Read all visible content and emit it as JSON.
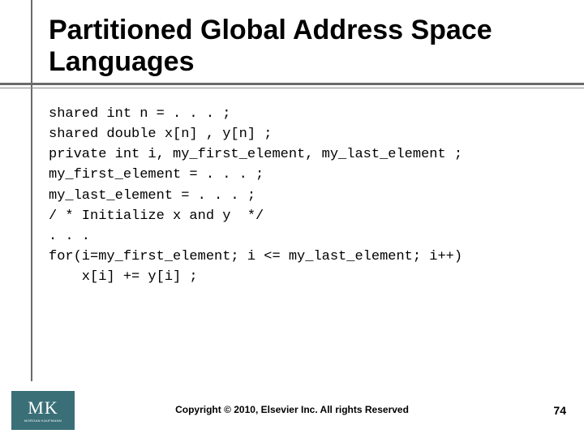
{
  "title": "Partitioned Global Address Space Languages",
  "code_lines": [
    "shared int n = . . . ;",
    "shared double x[n] , y[n] ;",
    "private int i, my_first_element, my_last_element ;",
    "my_first_element = . . . ;",
    "my_last_element = . . . ;",
    "/ * Initialize x and y  */",
    ". . .",
    "for(i=my_first_element; i <= my_last_element; i++)",
    "    x[i] += y[i] ;"
  ],
  "copyright": "Copyright © 2010, Elsevier Inc. All rights Reserved",
  "page_number": "74",
  "logo": {
    "main": "MK",
    "sub": "MORGAN KAUFMANN"
  },
  "colors": {
    "rule": "#6a6a6a",
    "logo_bg": "#3a6f78"
  }
}
